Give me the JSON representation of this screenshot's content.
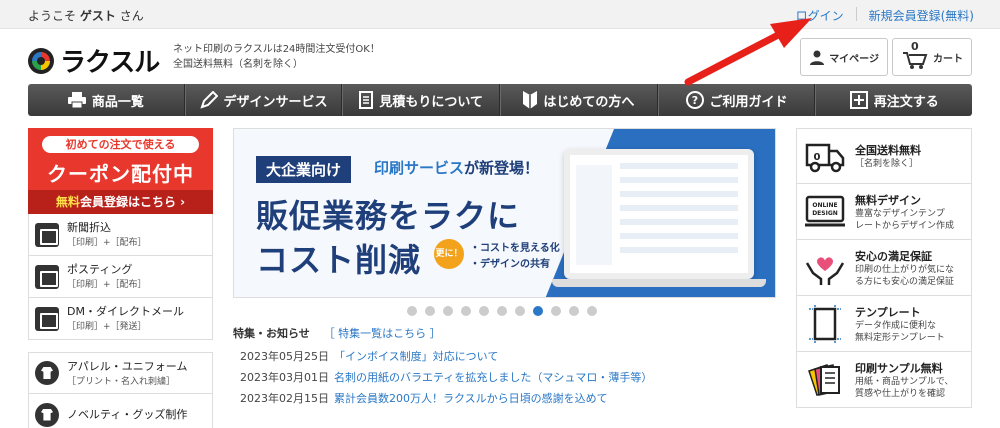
{
  "top": {
    "welcome_pre": "ようこそ",
    "welcome_user": "ゲスト",
    "welcome_post": "さん",
    "login": "ログイン",
    "register": "新規会員登録(無料)"
  },
  "header": {
    "logo": "ラクスル",
    "tagline1": "ネット印刷のラクスルは24時間注文受付OK！",
    "tagline2": "全国送料無料（名刺を除く）",
    "mypage": "マイページ",
    "cart_count": "0",
    "cart": "カート"
  },
  "nav": [
    {
      "label": "商品一覧",
      "icon": "printer-icon"
    },
    {
      "label": "デザインサービス",
      "icon": "pencil-icon"
    },
    {
      "label": "見積もりについて",
      "icon": "document-icon"
    },
    {
      "label": "はじめての方へ",
      "icon": "beginner-mark-icon"
    },
    {
      "label": "ご利用ガイド",
      "icon": "question-icon"
    },
    {
      "label": "再注文する",
      "icon": "reorder-icon"
    }
  ],
  "coupon": {
    "top": "初めての注文で使える",
    "main": "クーポン配付中",
    "bottom_free": "無料",
    "bottom_rest": "会員登録はこちら ›"
  },
  "side_items": [
    {
      "title": "新聞折込",
      "sub": "［印刷］+［配布］",
      "icon": "newspaper-icon"
    },
    {
      "title": "ポスティング",
      "sub": "［印刷］+［配布］",
      "icon": "mailbox-icon"
    },
    {
      "title": "DM・ダイレクトメール",
      "sub": "［印刷］+［発送］",
      "icon": "mail-icon"
    }
  ],
  "side_items2": [
    {
      "title": "アパレル・ユニフォーム",
      "sub": "［プリント・名入れ刺繍］",
      "icon": "tshirt-icon"
    },
    {
      "title": "ノベルティ・グッズ制作",
      "sub": "",
      "icon": "gift-icon"
    }
  ],
  "banner": {
    "badge": "大企業向け",
    "sub_hl": "印刷サービス",
    "sub_rest": "が新登場！",
    "head1": "販促業務をラクに",
    "head2": "コスト削減",
    "more": "更に！",
    "bullet1": "・コストを見える化",
    "bullet2": "・デザインの共有"
  },
  "carousel": {
    "count": 11,
    "active": 7
  },
  "news": {
    "title": "特集・お知らせ",
    "link": "［ 特集一覧はこちら ］",
    "items": [
      {
        "date": "2023年05月25日",
        "title": "「インボイス制度」対応について"
      },
      {
        "date": "2023年03月01日",
        "title": "名刺の用紙のバラエティを拡充しました（マシュマロ・薄手等）"
      },
      {
        "date": "2023年02月15日",
        "title": "累計会員数200万人！ラクスルから日頃の感謝を込めて"
      }
    ]
  },
  "right_items": [
    {
      "title": "全国送料無料",
      "desc1": "［名刺を除く］",
      "desc2": "",
      "icon": "truck-icon"
    },
    {
      "title": "無料デザイン",
      "desc1": "豊富なデザインテンプ",
      "desc2": "レートからデザイン作成",
      "icon": "online-design-icon"
    },
    {
      "title": "安心の満足保証",
      "desc1": "印刷の仕上がりが気にな",
      "desc2": "る方にも安心の満足保証",
      "icon": "heart-hands-icon"
    },
    {
      "title": "テンプレート",
      "desc1": "データ作成に便利な",
      "desc2": "無料定形テンプレート",
      "icon": "template-icon"
    },
    {
      "title": "印刷サンプル無料",
      "desc1": "用紙・商品サンプルで、",
      "desc2": "質感や仕上がりを確認",
      "icon": "sample-paper-icon"
    }
  ],
  "online_design_label1": "ONLINE",
  "online_design_label2": "DESIGN",
  "colors": {
    "accent": "#2a78c6",
    "coupon": "#e8382d",
    "nav": "#444444",
    "arrow": "#e8201a"
  }
}
